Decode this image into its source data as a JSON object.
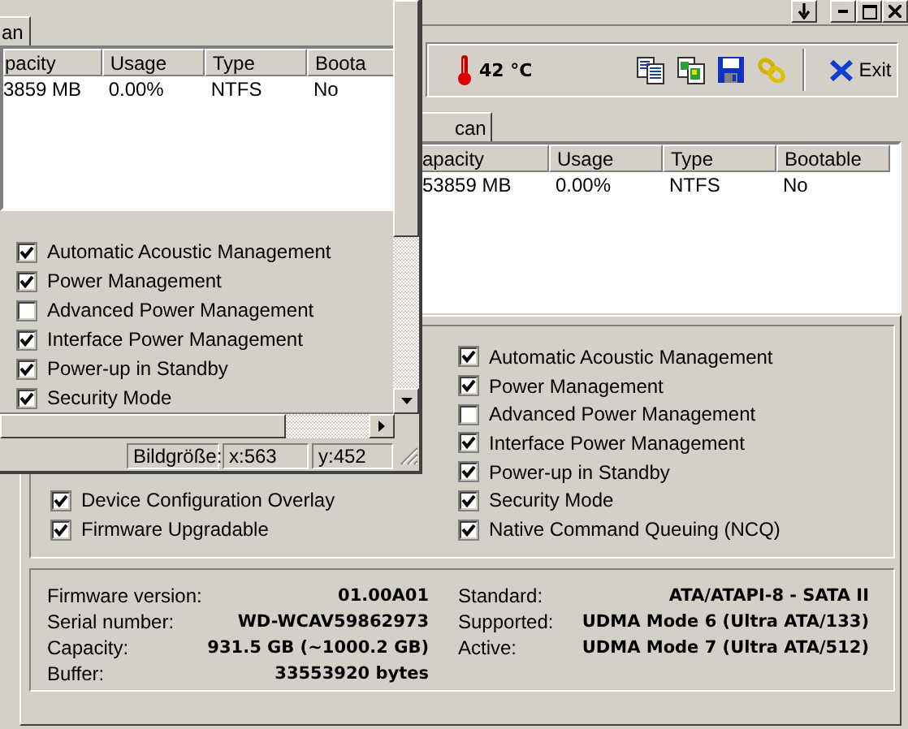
{
  "main_window": {
    "temperature": "42 °C",
    "exit_button": "Exit",
    "tab": {
      "label": "can",
      "selected": true
    },
    "table": {
      "columns": [
        "apacity",
        "Usage",
        "Type",
        "Bootable"
      ],
      "rows": [
        [
          "53859 MB",
          "0.00%",
          "NTFS",
          "No"
        ]
      ]
    },
    "features_left": [
      {
        "label": "Device Configuration Overlay",
        "checked": true
      },
      {
        "label": "Firmware Upgradable",
        "checked": true
      }
    ],
    "features_right": [
      {
        "label": "Automatic Acoustic Management",
        "checked": true
      },
      {
        "label": "Power Management",
        "checked": true
      },
      {
        "label": "Advanced Power Management",
        "checked": false
      },
      {
        "label": "Interface Power Management",
        "checked": true
      },
      {
        "label": "Power-up in Standby",
        "checked": true
      },
      {
        "label": "Security Mode",
        "checked": true
      },
      {
        "label": "Native Command Queuing (NCQ)",
        "checked": true
      }
    ],
    "info_left": [
      {
        "label": "Firmware version:",
        "value": "01.00A01"
      },
      {
        "label": "Serial number:",
        "value": "WD-WCAV59862973"
      },
      {
        "label": "Capacity:",
        "value": "931.5 GB (~1000.2 GB)"
      },
      {
        "label": "Buffer:",
        "value": "33553920 bytes"
      }
    ],
    "info_right": [
      {
        "label": "Standard:",
        "value": "ATA/ATAPI-8 - SATA II"
      },
      {
        "label": "Supported:",
        "value": "UDMA Mode 6 (Ultra ATA/133)"
      },
      {
        "label": "Active:",
        "value": "UDMA Mode 7 (Ultra ATA/512)"
      }
    ]
  },
  "viewer_window": {
    "tab": {
      "label": "an",
      "selected": true
    },
    "table": {
      "columns": [
        "pacity",
        "Usage",
        "Type",
        "Boota"
      ],
      "rows": [
        [
          "3859 MB",
          "0.00%",
          "NTFS",
          "No"
        ]
      ]
    },
    "features": [
      {
        "label": "Automatic Acoustic Management",
        "checked": true
      },
      {
        "label": "Power Management",
        "checked": true
      },
      {
        "label": "Advanced Power Management",
        "checked": false
      },
      {
        "label": "Interface Power Management",
        "checked": true
      },
      {
        "label": "Power-up in Standby",
        "checked": true
      },
      {
        "label": "Security Mode",
        "checked": true
      }
    ],
    "status_bar": [
      "Bildgröße:",
      "x:563",
      "y:452"
    ]
  }
}
